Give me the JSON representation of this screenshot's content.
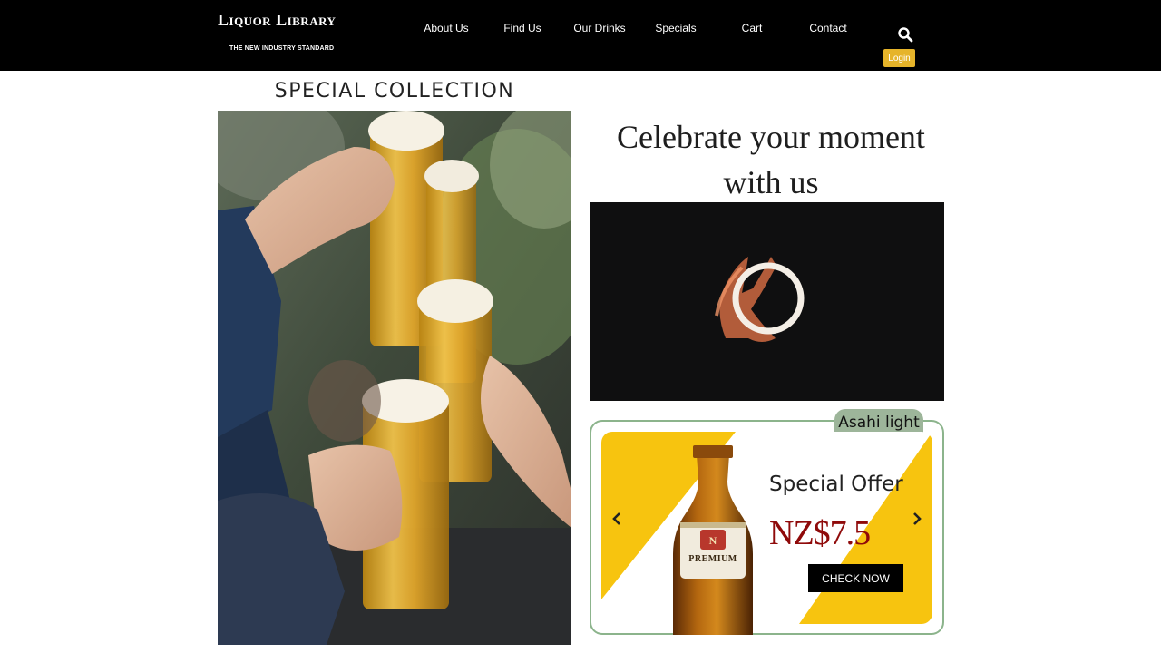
{
  "brand": {
    "name": "Liquor Library",
    "tagline": "THE NEW INDUSTRY STANDARD"
  },
  "nav": {
    "items": [
      "About Us",
      "Find Us",
      "Our Drinks",
      "Specials",
      "Cart",
      "Contact"
    ],
    "search_icon": "search-icon",
    "login_label": "Login"
  },
  "colors": {
    "header_bg": "#000000",
    "login_button": "#e6b42a",
    "offer_yellow": "#f7c40f",
    "price_red": "#8f0a0a",
    "card_border": "#8cb48c"
  },
  "main": {
    "collection_title": "SPECIAL COLLECTION",
    "hero_heading_line1": "Celebrate your moment",
    "hero_heading_line2": "with us"
  },
  "offer": {
    "product_name": "Asahi light",
    "title": "Special Offer",
    "price": "NZ$7.5",
    "cta_label": "CHECK NOW",
    "bottle_label": "PREMIUM",
    "prev_icon": "chevron-left-icon",
    "next_icon": "chevron-right-icon"
  }
}
